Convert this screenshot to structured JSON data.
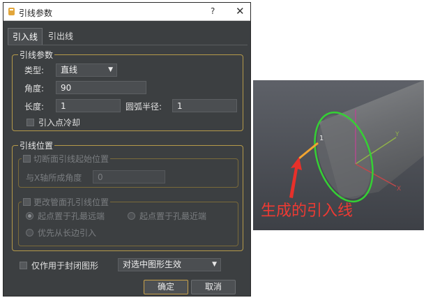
{
  "dialog": {
    "title": "引线参数",
    "help_label": "?",
    "close_label": "✕",
    "tabs": [
      {
        "label": "引入线",
        "active": true
      },
      {
        "label": "引出线",
        "active": false
      }
    ],
    "lead_params": {
      "group_title": "引线参数",
      "type_label": "类型:",
      "type_value": "直线",
      "angle_label": "角度:",
      "angle_value": "90",
      "length_label": "长度:",
      "length_value": "1",
      "radius_label": "圆弧半径:",
      "radius_value": "1",
      "cooling_label": "引入点冷却"
    },
    "lead_position": {
      "group_title": "引线位置",
      "cut_section_title": "切断面引线起始位置",
      "x_angle_label": "与X轴所成角度",
      "x_angle_value": "0",
      "pipe_hole_title": "更改管面孔引线位置",
      "radio_far": "起点置于孔最远端",
      "radio_near": "起点置于孔最近端",
      "radio_long_side": "优先从长边引入"
    },
    "closed_only_label": "仅作用于封闭图形",
    "apply_scope_value": "对选中图形生效",
    "ok_label": "确定",
    "cancel_label": "取消"
  },
  "illustration": {
    "marker_label": "1",
    "axis_y_label": "Y",
    "axis_x_label": "X",
    "caption": "生成的引入线"
  },
  "colors": {
    "dialog_bg": "#3c3f41",
    "group_border": "#b59a4a",
    "lead_line": "#f2a531",
    "circle": "#35d134",
    "caption": "#ee3a33"
  }
}
